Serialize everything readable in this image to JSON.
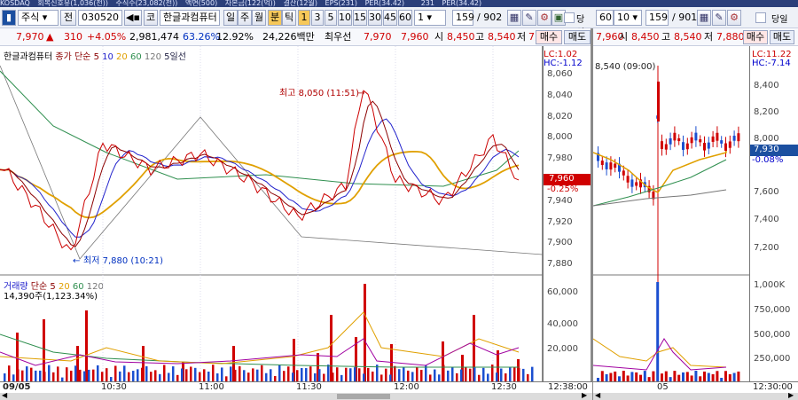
{
  "topbar": {
    "items": [
      "KOSDAQ",
      "회복신호유(1,036(전))",
      "주식수(23,082(천))",
      "액면(500)",
      "자본금(122(억))",
      "결산(12월)",
      "EPS(231)",
      "PER(34.42)",
      "231",
      "PER(34.42)"
    ]
  },
  "toolbar": {
    "type_select": "주식",
    "jeon_label": "전",
    "code_value": "030520",
    "ko_label": "코",
    "stock_name": "한글과컴퓨터",
    "period_buttons": [
      "일",
      "주",
      "월",
      "분",
      "틱"
    ],
    "minute_buttons": [
      "1",
      "3",
      "5",
      "10",
      "15",
      "30",
      "45",
      "60"
    ],
    "minute_select": "1",
    "count_value": "159",
    "count_total": "/ 902",
    "save_label": "당일",
    "right_period": "60",
    "right_count": "10",
    "right_count_value": "159",
    "right_count_total": "/ 901",
    "right_save_label": "당일"
  },
  "quote": {
    "price": "7,970",
    "arrow": "▲",
    "change": "310",
    "pct": "+4.05%",
    "volume": "2,981,474",
    "ratio1": "63.26%",
    "ratio2": "12.92%",
    "amount": "24,226백만",
    "best_label": "최우선",
    "bid": "7,970",
    "ask": "7,960",
    "open_label": "시",
    "open": "8,450",
    "high_label": "고",
    "high": "8,540",
    "low_label": "저",
    "low": "7,880",
    "buy_label": "매수",
    "sell_label": "매도",
    "r_bid": "7,960",
    "r_open_label": "시",
    "r_open": "8,450",
    "r_high_label": "고",
    "r_high": "8,540",
    "r_low_label": "저",
    "r_low": "7,880",
    "r_buy_label": "매수",
    "r_sell_label": "매도"
  },
  "colors": {
    "price_line": "#cc0000",
    "ma5": "#8b0000",
    "ma10": "#2222cc",
    "ma20": "#e0a000",
    "ma60": "#2f8f4f",
    "ma120": "#777777",
    "accent_up": "#d00000",
    "accent_down": "#0030c0"
  },
  "left_chart": {
    "legend_name": "한글과컴퓨터",
    "legend_ma": "종가 단순",
    "ma_periods": [
      "5",
      "10",
      "20",
      "60",
      "120"
    ],
    "legend_tf": "5일선",
    "lc_text": "LC:1.02",
    "hc_text": "HC:-1.12",
    "yticks": [
      "8,060",
      "8,040",
      "8,020",
      "8,000",
      "7,980",
      "7,960",
      "7,940",
      "7,920",
      "7,900",
      "7,880"
    ],
    "current_price": "7,960",
    "current_pct": "-0.25%",
    "high_note": "최고 8,050 (11:51)",
    "low_note": "최저 7,880 (10:21)",
    "vol_legend": "거래량",
    "vol_ma": "단순",
    "vol_periods": [
      "5",
      "20",
      "60",
      "120"
    ],
    "vol_info": "14,390주(1,123.34%)",
    "vol_yticks": [
      "60,000",
      "40,000",
      "20,000"
    ],
    "xticks": [
      "09/05",
      "10:30",
      "11:00",
      "11:30",
      "12:00",
      "12:30"
    ],
    "x_right": "12:38:00"
  },
  "right_chart": {
    "lc_text": "LC:11.22",
    "hc_text": "HC:-7.14",
    "high_note": "8,540 (09:00)",
    "yticks": [
      "8,400",
      "8,200",
      "8,000",
      "7,600",
      "7,400",
      "7,200"
    ],
    "current_price": "7,930",
    "current_pct": "-0.08%",
    "vol_yticks": [
      "1,000K",
      "750,000",
      "500,000",
      "250,000"
    ],
    "xtick": "05",
    "x_right": "12:30:00"
  },
  "chart_data": {
    "type": "line",
    "title": "",
    "xlabel": "",
    "ylabel": "",
    "x": [
      "10:00",
      "10:15",
      "10:21",
      "10:30",
      "10:45",
      "11:00",
      "11:15",
      "11:30",
      "11:45",
      "11:51",
      "12:00",
      "12:15",
      "12:30",
      "12:38"
    ],
    "ylim": [
      7870,
      8070
    ],
    "series": [
      {
        "name": "",
        "values": [
          7975,
          7935,
          7890,
          7995,
          7970,
          7985,
          7960,
          7925,
          7955,
          8050,
          7960,
          7940,
          8000,
          7960
        ]
      }
    ]
  }
}
